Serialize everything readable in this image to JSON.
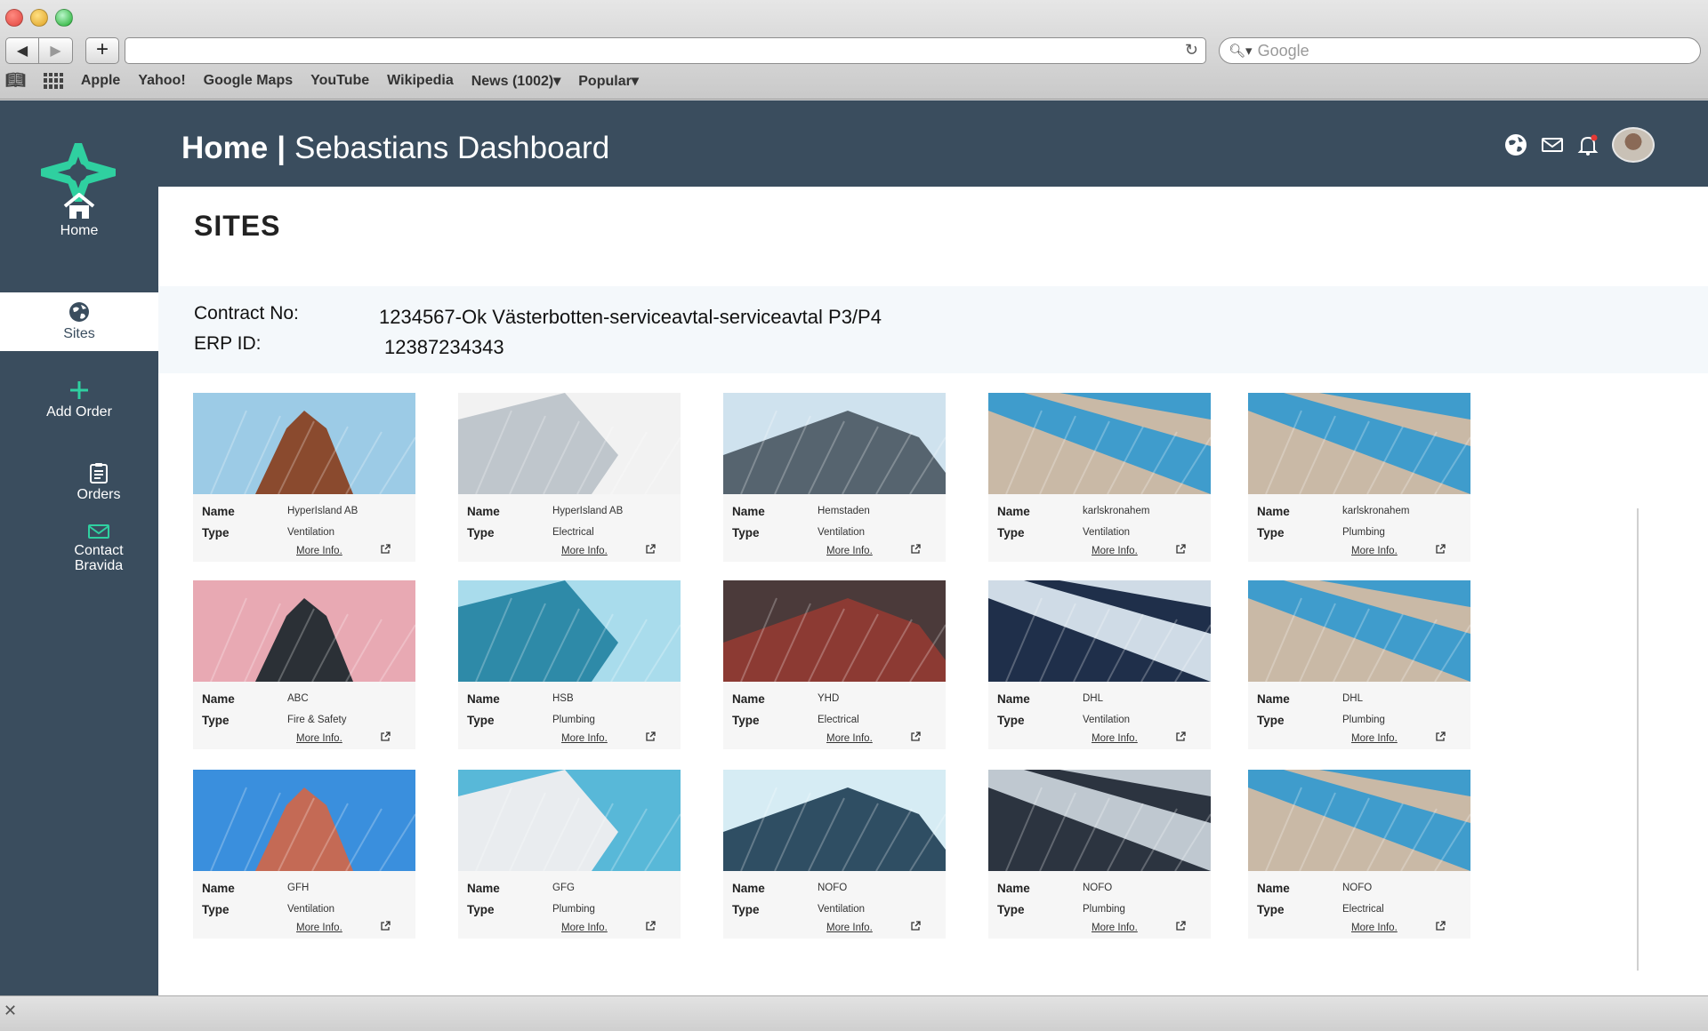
{
  "browser": {
    "search_placeholder": "Google",
    "bookmarks": [
      "Apple",
      "Yahoo!",
      "Google Maps",
      "YouTube",
      "Wikipedia",
      "News (1002)▾",
      "Popular▾"
    ]
  },
  "app": {
    "title_home": "Home",
    "title_dashboard": "Sebastians Dashboard",
    "accent": "#2fd0a0",
    "sidebar_bg": "#3a4d5e"
  },
  "sidebar": {
    "items": [
      {
        "label": "Home",
        "icon": "home-icon"
      },
      {
        "label": "Sites",
        "icon": "globe-icon"
      },
      {
        "label": "Add Order",
        "icon": "plus-icon"
      },
      {
        "label": "Orders",
        "icon": "clipboard-icon"
      },
      {
        "label": "Contact Bravida",
        "icon": "mail-icon"
      }
    ]
  },
  "main": {
    "heading": "SITES",
    "contract_label": "Contract No:",
    "contract_value": "1234567-Ok Västerbotten-serviceavtal-serviceavtal P3/P4",
    "erp_label": "ERP ID:",
    "erp_value": "12387234343",
    "name_label": "Name",
    "type_label": "Type",
    "more_label": "More Info.",
    "cards": [
      {
        "name": "HyperIsland AB",
        "type": "Ventilation",
        "sky": "#9ccbe6",
        "building": "#8a4a2e"
      },
      {
        "name": "HyperIsland AB",
        "type": "Electrical",
        "sky": "#f2f2f2",
        "building": "#bfc6cc"
      },
      {
        "name": "Hemstaden",
        "type": "Ventilation",
        "sky": "#cfe2ee",
        "building": "#56646f"
      },
      {
        "name": "karlskronahem",
        "type": "Ventilation",
        "sky": "#3f9ccc",
        "building": "#c9b9a6"
      },
      {
        "name": "karlskronahem",
        "type": "Plumbing",
        "sky": "#3f9ccc",
        "building": "#c9b9a6"
      },
      {
        "name": "ABC",
        "type": "Fire & Safety",
        "sky": "#e8a9b3",
        "building": "#2b3036"
      },
      {
        "name": "HSB",
        "type": "Plumbing",
        "sky": "#a9dcec",
        "building": "#2e8aa8"
      },
      {
        "name": "YHD",
        "type": "Electrical",
        "sky": "#4b3a3a",
        "building": "#8c3a33"
      },
      {
        "name": "DHL",
        "type": "Ventilation",
        "sky": "#cfdbe6",
        "building": "#1f2f4a"
      },
      {
        "name": "DHL",
        "type": "Plumbing",
        "sky": "#3f9ccc",
        "building": "#c9b9a6"
      },
      {
        "name": "GFH",
        "type": "Ventilation",
        "sky": "#3a8fdd",
        "building": "#c46a55"
      },
      {
        "name": "GFG",
        "type": "Plumbing",
        "sky": "#58b8d8",
        "building": "#e9ecef"
      },
      {
        "name": "NOFO",
        "type": "Ventilation",
        "sky": "#d6ecf4",
        "building": "#2f4e63"
      },
      {
        "name": "NOFO",
        "type": "Plumbing",
        "sky": "#bfc8d0",
        "building": "#2c3440"
      },
      {
        "name": "NOFO",
        "type": "Electrical",
        "sky": "#3f9ccc",
        "building": "#c9b9a6"
      }
    ]
  }
}
